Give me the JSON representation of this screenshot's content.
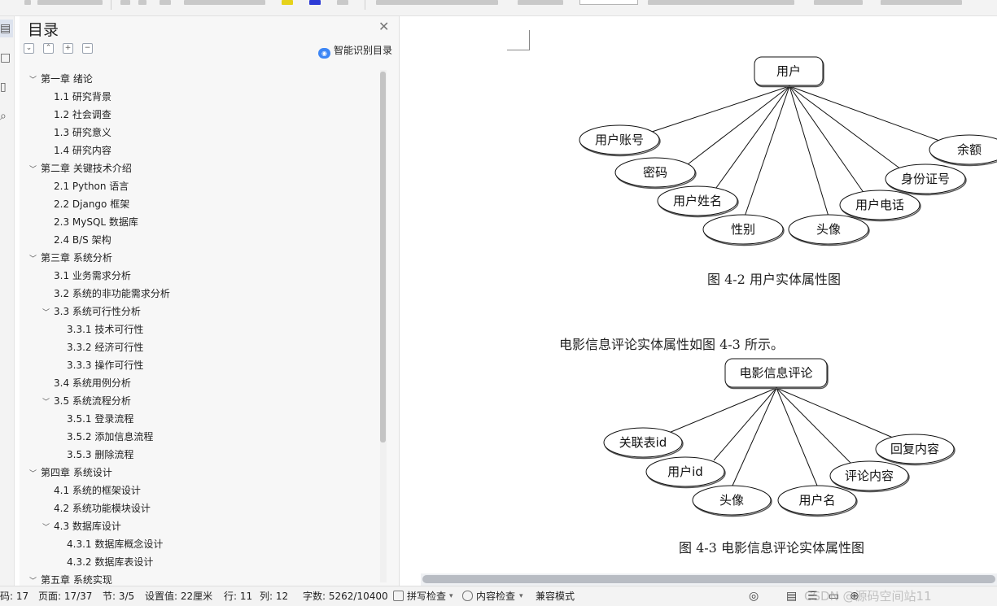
{
  "toc": {
    "title": "目录",
    "smart_label": "智能识别目录",
    "items": [
      {
        "label": "第一章  绪论",
        "level": 0,
        "chevron": true
      },
      {
        "label": "1.1 研究背景",
        "level": 1,
        "chevron": false
      },
      {
        "label": "1.2 社会调查",
        "level": 1,
        "chevron": false
      },
      {
        "label": "1.3 研究意义",
        "level": 1,
        "chevron": false
      },
      {
        "label": "1.4 研究内容",
        "level": 1,
        "chevron": false
      },
      {
        "label": "第二章  关键技术介绍",
        "level": 0,
        "chevron": true
      },
      {
        "label": "2.1 Python 语言",
        "level": 1,
        "chevron": false
      },
      {
        "label": "2.2 Django 框架",
        "level": 1,
        "chevron": false
      },
      {
        "label": "2.3 MySQL 数据库",
        "level": 1,
        "chevron": false
      },
      {
        "label": "2.4 B/S 架构",
        "level": 1,
        "chevron": false
      },
      {
        "label": "第三章  系统分析",
        "level": 0,
        "chevron": true
      },
      {
        "label": "3.1 业务需求分析",
        "level": 1,
        "chevron": false
      },
      {
        "label": "3.2 系统的非功能需求分析",
        "level": 1,
        "chevron": false
      },
      {
        "label": "3.3 系统可行性分析",
        "level": 1,
        "chevron": true
      },
      {
        "label": "3.3.1  技术可行性",
        "level": 2,
        "chevron": false
      },
      {
        "label": "3.3.2  经济可行性",
        "level": 2,
        "chevron": false
      },
      {
        "label": "3.3.3  操作可行性",
        "level": 2,
        "chevron": false
      },
      {
        "label": "3.4  系统用例分析",
        "level": 1,
        "chevron": false
      },
      {
        "label": "3.5  系统流程分析",
        "level": 1,
        "chevron": true
      },
      {
        "label": "3.5.1  登录流程",
        "level": 2,
        "chevron": false
      },
      {
        "label": "3.5.2  添加信息流程",
        "level": 2,
        "chevron": false
      },
      {
        "label": "3.5.3  删除流程",
        "level": 2,
        "chevron": false
      },
      {
        "label": "第四章  系统设计",
        "level": 0,
        "chevron": true
      },
      {
        "label": "4.1 系统的框架设计",
        "level": 1,
        "chevron": false
      },
      {
        "label": "4.2 系统功能模块设计",
        "level": 1,
        "chevron": false
      },
      {
        "label": "4.3  数据库设计",
        "level": 1,
        "chevron": true
      },
      {
        "label": "4.3.1 数据库概念设计",
        "level": 2,
        "chevron": false
      },
      {
        "label": "4.3.2  数据库表设计",
        "level": 2,
        "chevron": false
      },
      {
        "label": "第五章  系统实现",
        "level": 0,
        "chevron": true
      }
    ]
  },
  "document": {
    "figure1": {
      "entity": "用户",
      "attributes": [
        "用户账号",
        "密码",
        "用户姓名",
        "性别",
        "头像",
        "用户电话",
        "身份证号",
        "余额"
      ],
      "caption": "图 4-2 用户实体属性图"
    },
    "paragraph": "电影信息评论实体属性如图 4-3 所示。",
    "figure2": {
      "entity": "电影信息评论",
      "attributes": [
        "关联表id",
        "用户id",
        "头像",
        "用户名",
        "评论内容",
        "回复内容"
      ],
      "caption": "图 4-3 电影信息评论实体属性图"
    }
  },
  "status": {
    "page_code": "码: 17",
    "page": "页面: 17/37",
    "section": "节: 3/5",
    "setting": "设置值: 22厘米",
    "row": "行: 11",
    "col": "列: 12",
    "words": "字数: 5262/10400",
    "spell": "拼写检查",
    "content_check": "内容检查",
    "compat": "兼容模式",
    "watermark": "CSDN @源码空间站11"
  }
}
